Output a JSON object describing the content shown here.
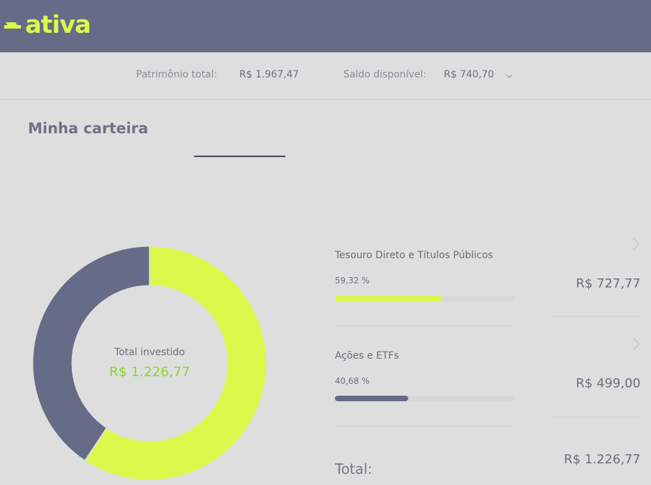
{
  "header": {
    "logo_text": "ativa",
    "background_color": "#666b88",
    "accent_color": "#dbf94b"
  },
  "summary": {
    "patrimonio_label": "Patrimônio total:",
    "patrimonio_value": "R$ 1.967,47",
    "saldo_label": "Saldo disponível:",
    "saldo_value": "R$ 740,70"
  },
  "page": {
    "title": "Minha carteira"
  },
  "donut": {
    "center_label": "Total investido",
    "center_value": "R$ 1.226,77",
    "segments": [
      {
        "name": "Tesouro Direto e Títulos Públicos",
        "fraction": 0.5932,
        "color": "#dbf94b"
      },
      {
        "name": "Ações e ETFs",
        "fraction": 0.4068,
        "color": "#666b88"
      }
    ]
  },
  "categories": [
    {
      "name": "Tesouro Direto e Títulos Públicos",
      "percent_label": "59,32 %",
      "percent": 59.32,
      "amount": "R$ 727,77",
      "color": "#dbf94b"
    },
    {
      "name": "Ações e ETFs",
      "percent_label": "40,68 %",
      "percent": 40.68,
      "amount": "R$ 499,00",
      "color": "#666b88"
    }
  ],
  "total": {
    "label": "Total:",
    "value": "R$ 1.226,77"
  }
}
